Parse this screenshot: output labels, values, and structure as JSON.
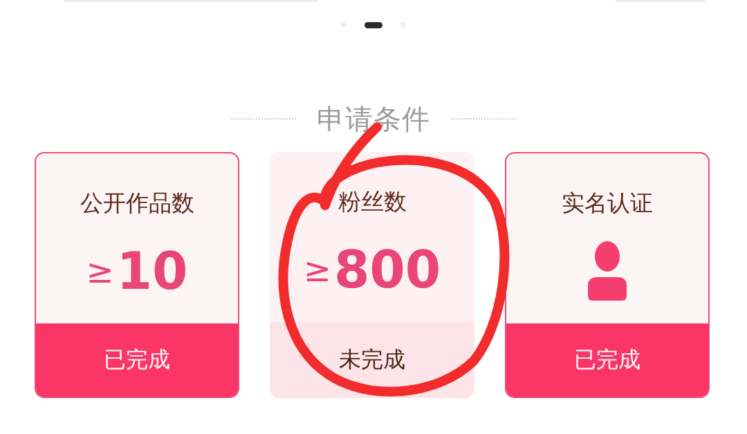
{
  "carousel": {
    "pages": [
      {
        "selected": false
      },
      {
        "selected": true
      },
      {
        "selected": false
      }
    ]
  },
  "section_title": "申请条件",
  "conditions": [
    {
      "kind": "threshold",
      "label": "公开作品数",
      "comparator": "≥",
      "value": "10",
      "status": "已完成",
      "completed": true
    },
    {
      "kind": "threshold",
      "label": "粉丝数",
      "comparator": "≥",
      "value": "800",
      "status": "未完成",
      "completed": false
    },
    {
      "kind": "identity",
      "label": "实名认证",
      "status": "已完成",
      "completed": true
    }
  ],
  "annotation": {
    "kind": "circle"
  }
}
